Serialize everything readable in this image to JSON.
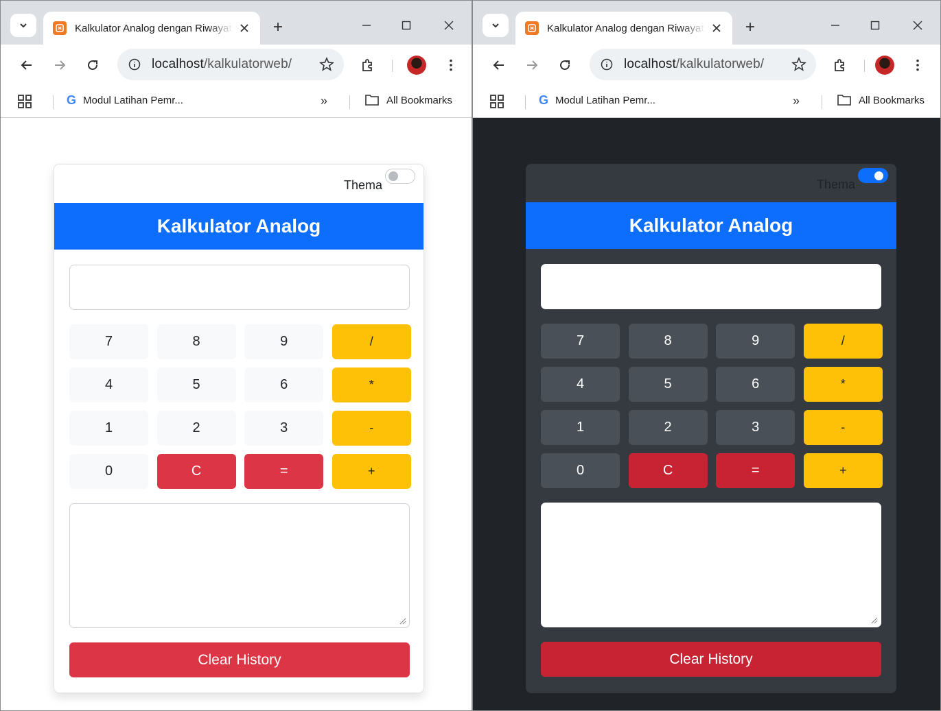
{
  "tab": {
    "title": "Kalkulator Analog dengan Riwayat"
  },
  "omnibox": {
    "host": "localhost",
    "path": "/kalkulatorweb/"
  },
  "bookmarks": {
    "item": "Modul Latihan Pemr...",
    "more": "»",
    "all": "All Bookmarks"
  },
  "calculator": {
    "theme_label": "Thema",
    "title": "Kalkulator Analog",
    "keys": [
      "7",
      "8",
      "9",
      "/",
      "4",
      "5",
      "6",
      "*",
      "1",
      "2",
      "3",
      "-",
      "0",
      "C",
      "=",
      "+"
    ],
    "clear_label": "Clear History"
  },
  "themes": {
    "left": "light",
    "right": "dark"
  },
  "colors": {
    "primary": "#0d6efd",
    "warning": "#ffc107",
    "danger": "#dc3545",
    "dark_bg": "#202428",
    "dark_card": "#343a40"
  },
  "icons": [
    "tab-search-icon",
    "favicon-icon",
    "close-icon",
    "plus-icon",
    "minimize-icon",
    "maximize-icon",
    "back-icon",
    "forward-icon",
    "reload-icon",
    "info-icon",
    "star-icon",
    "extensions-icon",
    "avatar",
    "kebab-menu-icon",
    "apps-icon",
    "google-icon",
    "folder-icon"
  ]
}
